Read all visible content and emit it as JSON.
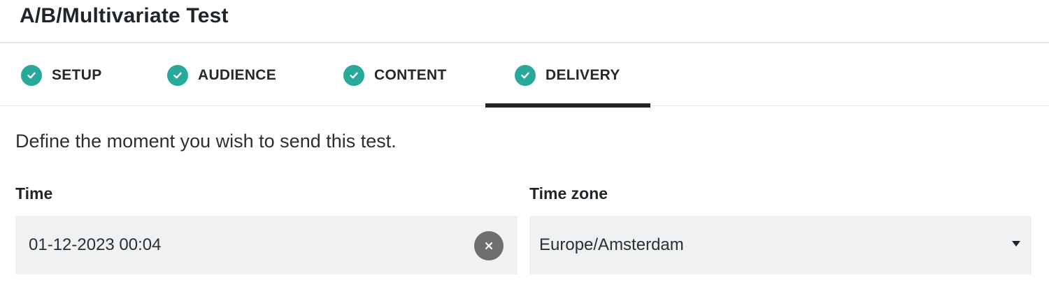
{
  "header": {
    "title": "A/B/Multivariate Test"
  },
  "tabs": [
    {
      "label": "SETUP",
      "icon": "check-circle-icon",
      "completed": true,
      "active": false
    },
    {
      "label": "AUDIENCE",
      "icon": "check-circle-icon",
      "completed": true,
      "active": false
    },
    {
      "label": "CONTENT",
      "icon": "check-circle-icon",
      "completed": true,
      "active": false
    },
    {
      "label": "DELIVERY",
      "icon": "check-circle-icon",
      "completed": true,
      "active": true
    }
  ],
  "main": {
    "intro": "Define the moment you wish to send this test.",
    "time": {
      "label": "Time",
      "value": "01-12-2023 00:04",
      "clear_icon": "close-icon"
    },
    "timezone": {
      "label": "Time zone",
      "value": "Europe/Amsterdam",
      "dropdown_icon": "caret-down-icon"
    }
  },
  "colors": {
    "accent": "#29a99a",
    "text": "#1f2528",
    "field_bg": "#f0f1f2",
    "clear_button": "#6f6f6f",
    "active_tab_underline": "#1f2528"
  }
}
